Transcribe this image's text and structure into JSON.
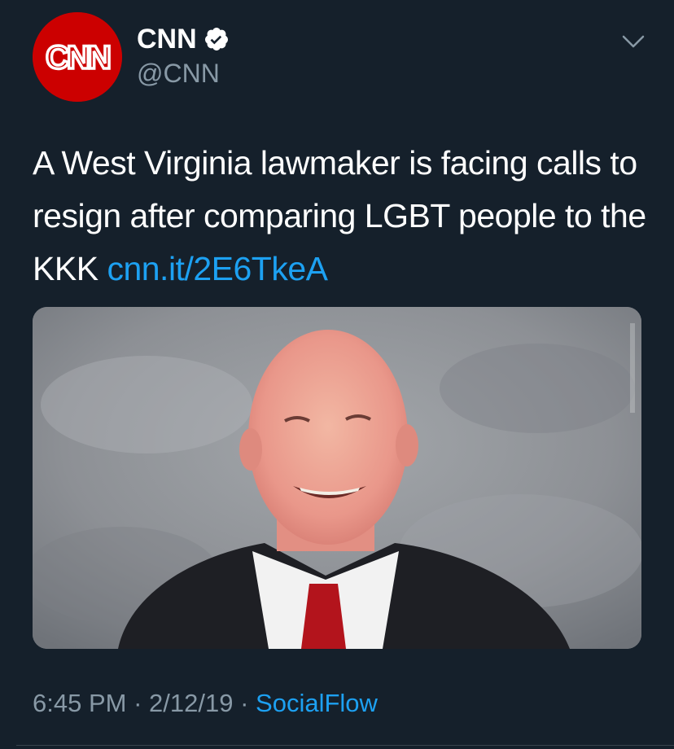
{
  "author": {
    "display_name": "CNN",
    "handle": "@CNN",
    "avatar_logo_text": "CNN",
    "verified": true
  },
  "tweet": {
    "text": "A West Virginia lawmaker is facing calls to resign after comparing LGBT people to the KKK",
    "link": "cnn.it/2E6TkeA"
  },
  "media": {
    "image_description_icon": "photo-of-lawmaker"
  },
  "meta": {
    "time": "6:45 PM",
    "separator": "·",
    "date": "2/12/19",
    "source": "SocialFlow"
  },
  "colors": {
    "background": "#15202b",
    "link": "#1da1f2",
    "secondary_text": "#8899a6",
    "avatar_red": "#cc0000"
  }
}
